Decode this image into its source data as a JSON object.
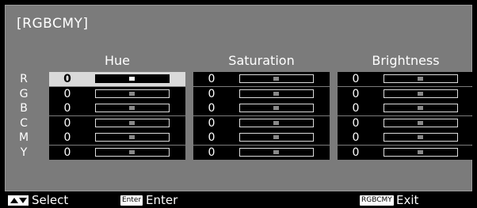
{
  "menu": {
    "title": "[RGBCMY]",
    "columns": [
      "Hue",
      "Saturation",
      "Brightness"
    ],
    "rows": [
      {
        "label": "R",
        "values": [
          "0",
          "0",
          "0"
        ]
      },
      {
        "label": "G",
        "values": [
          "0",
          "0",
          "0"
        ]
      },
      {
        "label": "B",
        "values": [
          "0",
          "0",
          "0"
        ]
      },
      {
        "label": "C",
        "values": [
          "0",
          "0",
          "0"
        ]
      },
      {
        "label": "M",
        "values": [
          "0",
          "0",
          "0"
        ]
      },
      {
        "label": "Y",
        "values": [
          "0",
          "0",
          "0"
        ]
      }
    ],
    "selected": {
      "row": "R",
      "column": "Hue"
    }
  },
  "footer": {
    "select_icon": "up-down-arrows-icon",
    "select_label": "Select",
    "enter_key": "Enter",
    "enter_label": "Enter",
    "exit_key": "RGBCMY",
    "exit_label": "Exit"
  },
  "colors": {
    "panel_bg": "#7b7b7b",
    "cell_bg": "#000000",
    "selected_bg": "#d9d9d9",
    "text": "#ffffff"
  }
}
